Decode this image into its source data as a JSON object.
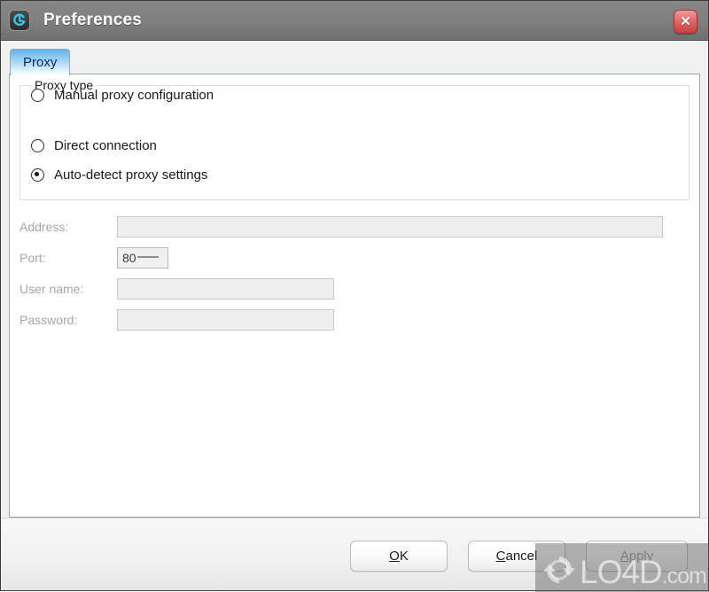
{
  "window": {
    "title": "Preferences",
    "app_icon": "app-logo-icon",
    "close_icon": "close-icon",
    "close_label": "✕"
  },
  "tabs": [
    {
      "label": "Proxy",
      "selected": true
    }
  ],
  "group": {
    "legend": "Proxy type",
    "options": [
      {
        "label": "Direct connection",
        "checked": false
      },
      {
        "label": "Auto-detect proxy settings",
        "checked": true
      },
      {
        "label": "Manual proxy configuration",
        "checked": false
      }
    ]
  },
  "form": {
    "address": {
      "label": "Address:",
      "value": "",
      "placeholder": "",
      "disabled": true
    },
    "port": {
      "label": "Port:",
      "value": "80",
      "mask_fill": "",
      "disabled": true
    },
    "username": {
      "label": "User name:",
      "value": "",
      "placeholder": "",
      "disabled": true
    },
    "password": {
      "label": "Password:",
      "value": "",
      "placeholder": "",
      "disabled": true
    }
  },
  "footer": {
    "ok": {
      "mnemonic": "O",
      "rest": "K",
      "disabled": false
    },
    "cancel": {
      "mnemonic": "C",
      "rest": "ancel",
      "disabled": false
    },
    "apply": {
      "mnemonic": "A",
      "rest": "pply",
      "disabled": true
    }
  },
  "watermark": {
    "text": "LO4D",
    "suffix": ".com",
    "logo": "refresh-arrows-icon"
  },
  "colors": {
    "titlebar": "#7f7f7f",
    "tab_accent": "#64b5ec",
    "close_button": "#c93f3f",
    "disabled_text": "#a6a6a6"
  }
}
